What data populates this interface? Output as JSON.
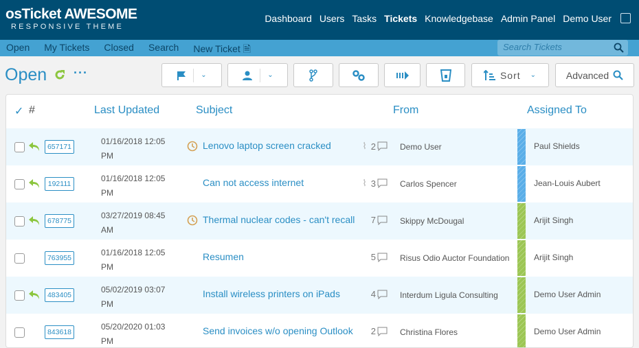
{
  "brand": {
    "name": "osTicket AWESOME",
    "tagline": "RESPONSIVE THEME"
  },
  "topnav": [
    "Dashboard",
    "Users",
    "Tasks",
    "Tickets",
    "Knowledgebase",
    "Admin Panel",
    "Demo User"
  ],
  "subnav": [
    "Open",
    "My Tickets",
    "Closed",
    "Search",
    "New Ticket"
  ],
  "search": {
    "placeholder": "Search Tickets"
  },
  "page": {
    "title": "Open",
    "more": "···"
  },
  "toolbar": {
    "sort": "Sort",
    "advanced": "Advanced"
  },
  "columns": {
    "check": "✓",
    "number": "#",
    "updated": "Last Updated",
    "subject": "Subject",
    "from": "From",
    "assigned": "Assigned To"
  },
  "colors": {
    "accent": "#2a8ec4",
    "header": "#004d73",
    "subnav": "#44a2d2",
    "priority_blue": "#5aaee8",
    "priority_green": "#9cc654"
  },
  "tickets": [
    {
      "number": "657171",
      "date": "01/16/2018 12:05 PM",
      "subject": "Lenovo laptop screen cracked",
      "overdue": true,
      "replied": true,
      "attach": true,
      "count": "2",
      "from": "Demo User",
      "assigned": "Paul Shields",
      "priority": "blue"
    },
    {
      "number": "192111",
      "date": "01/16/2018 12:05 PM",
      "subject": "Can not access internet",
      "overdue": false,
      "replied": true,
      "attach": true,
      "count": "3",
      "from": "Carlos Spencer",
      "assigned": "Jean-Louis Aubert",
      "priority": "blue"
    },
    {
      "number": "678775",
      "date": "03/27/2019 08:45 AM",
      "subject": "Thermal nuclear codes - can't recall",
      "overdue": true,
      "replied": true,
      "attach": false,
      "count": "7",
      "from": "Skippy McDougal",
      "assigned": "Arijit Singh",
      "priority": "green"
    },
    {
      "number": "763955",
      "date": "01/16/2018 12:05 PM",
      "subject": "Resumen",
      "overdue": false,
      "replied": false,
      "attach": false,
      "count": "5",
      "from": "Risus Odio Auctor Foundation",
      "assigned": "Arijit Singh",
      "priority": "green"
    },
    {
      "number": "483405",
      "date": "05/02/2019 03:07 PM",
      "subject": "Install wireless printers on iPads",
      "overdue": false,
      "replied": true,
      "attach": false,
      "count": "4",
      "from": "Interdum Ligula Consulting",
      "assigned": "Demo User Admin",
      "priority": "green"
    },
    {
      "number": "843618",
      "date": "05/20/2020 01:03 PM",
      "subject": "Send invoices w/o opening Outlook",
      "overdue": false,
      "replied": false,
      "attach": false,
      "count": "2",
      "from": "Christina Flores",
      "assigned": "Demo User Admin",
      "priority": "green"
    }
  ]
}
